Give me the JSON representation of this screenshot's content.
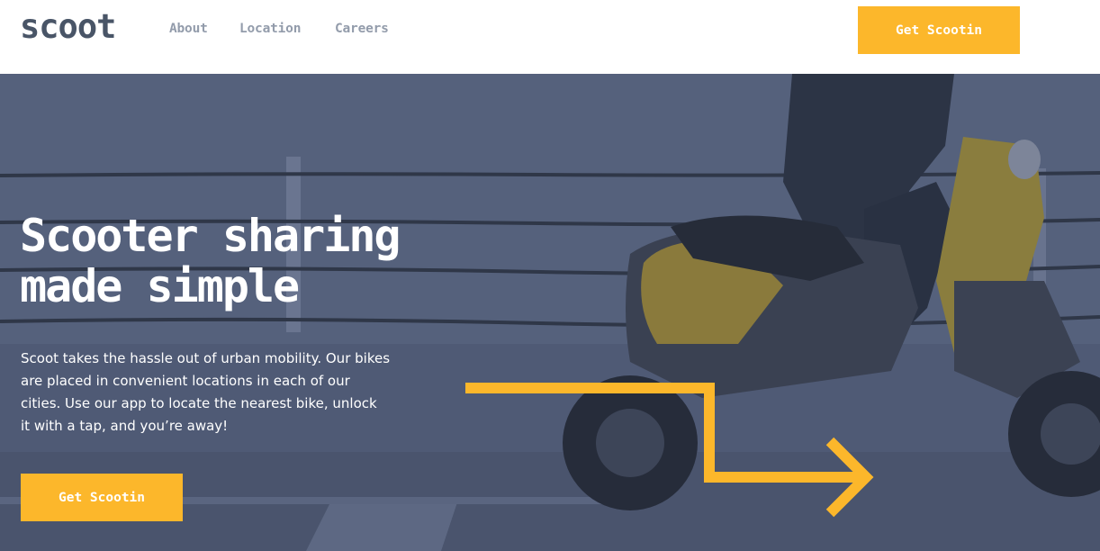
{
  "header": {
    "logo": "scoot",
    "nav": [
      {
        "label": "About"
      },
      {
        "label": "Location"
      },
      {
        "label": "Careers"
      }
    ],
    "cta_label": "Get Scootin"
  },
  "hero": {
    "title_line1": "Scooter sharing",
    "title_line2": "made simple",
    "description": "Scoot takes the hassle out of urban mobility. Our bikes are placed in convenient locations in each of our cities. Use our app to locate the nearest bike, unlock it with a tap, and you’re away!",
    "cta_label": "Get Scootin"
  },
  "colors": {
    "accent": "#fcb72b",
    "logo": "#495567",
    "nav_text": "#939cab",
    "hero_overlay": "#4b5673",
    "text_light": "#ffffff"
  },
  "icons": {
    "arrow": "arrow-right-icon"
  }
}
